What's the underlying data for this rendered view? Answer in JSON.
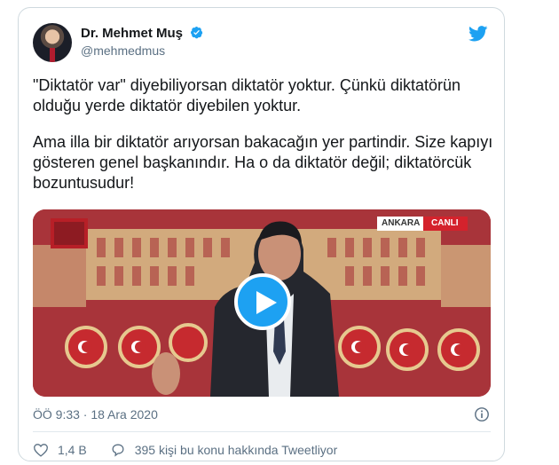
{
  "tweet": {
    "author_name": "Dr. Mehmet Muş",
    "handle": "@mehmedmus",
    "paragraph1": "\"Diktatör var\" diyebiliyorsan diktatör yoktur. Çünkü diktatörün olduğu yerde diktatör diyebilen yoktur.",
    "paragraph2": "Ama illa bir diktatör arıyorsan bakacağın yer partindir. Size kapıyı gösteren genel başkanındır. Ha o da diktatör değil; diktatörcük bozuntusudur!",
    "timestamp": "ÖÖ 9:33 · 18 Ara 2020",
    "likes": "1,4 B",
    "talking": "395 kişi bu konu hakkında Tweetliyor"
  },
  "media": {
    "badge_city": "ANKARA",
    "badge_live": "CANLI"
  },
  "colors": {
    "twitter_blue": "#1da1f2",
    "text": "#14171a",
    "muted": "#5b7083",
    "border": "#cfd9de"
  },
  "icons": [
    "verified-badge-icon",
    "twitter-bird-icon",
    "play-icon",
    "info-icon",
    "heart-icon",
    "comment-icon"
  ]
}
